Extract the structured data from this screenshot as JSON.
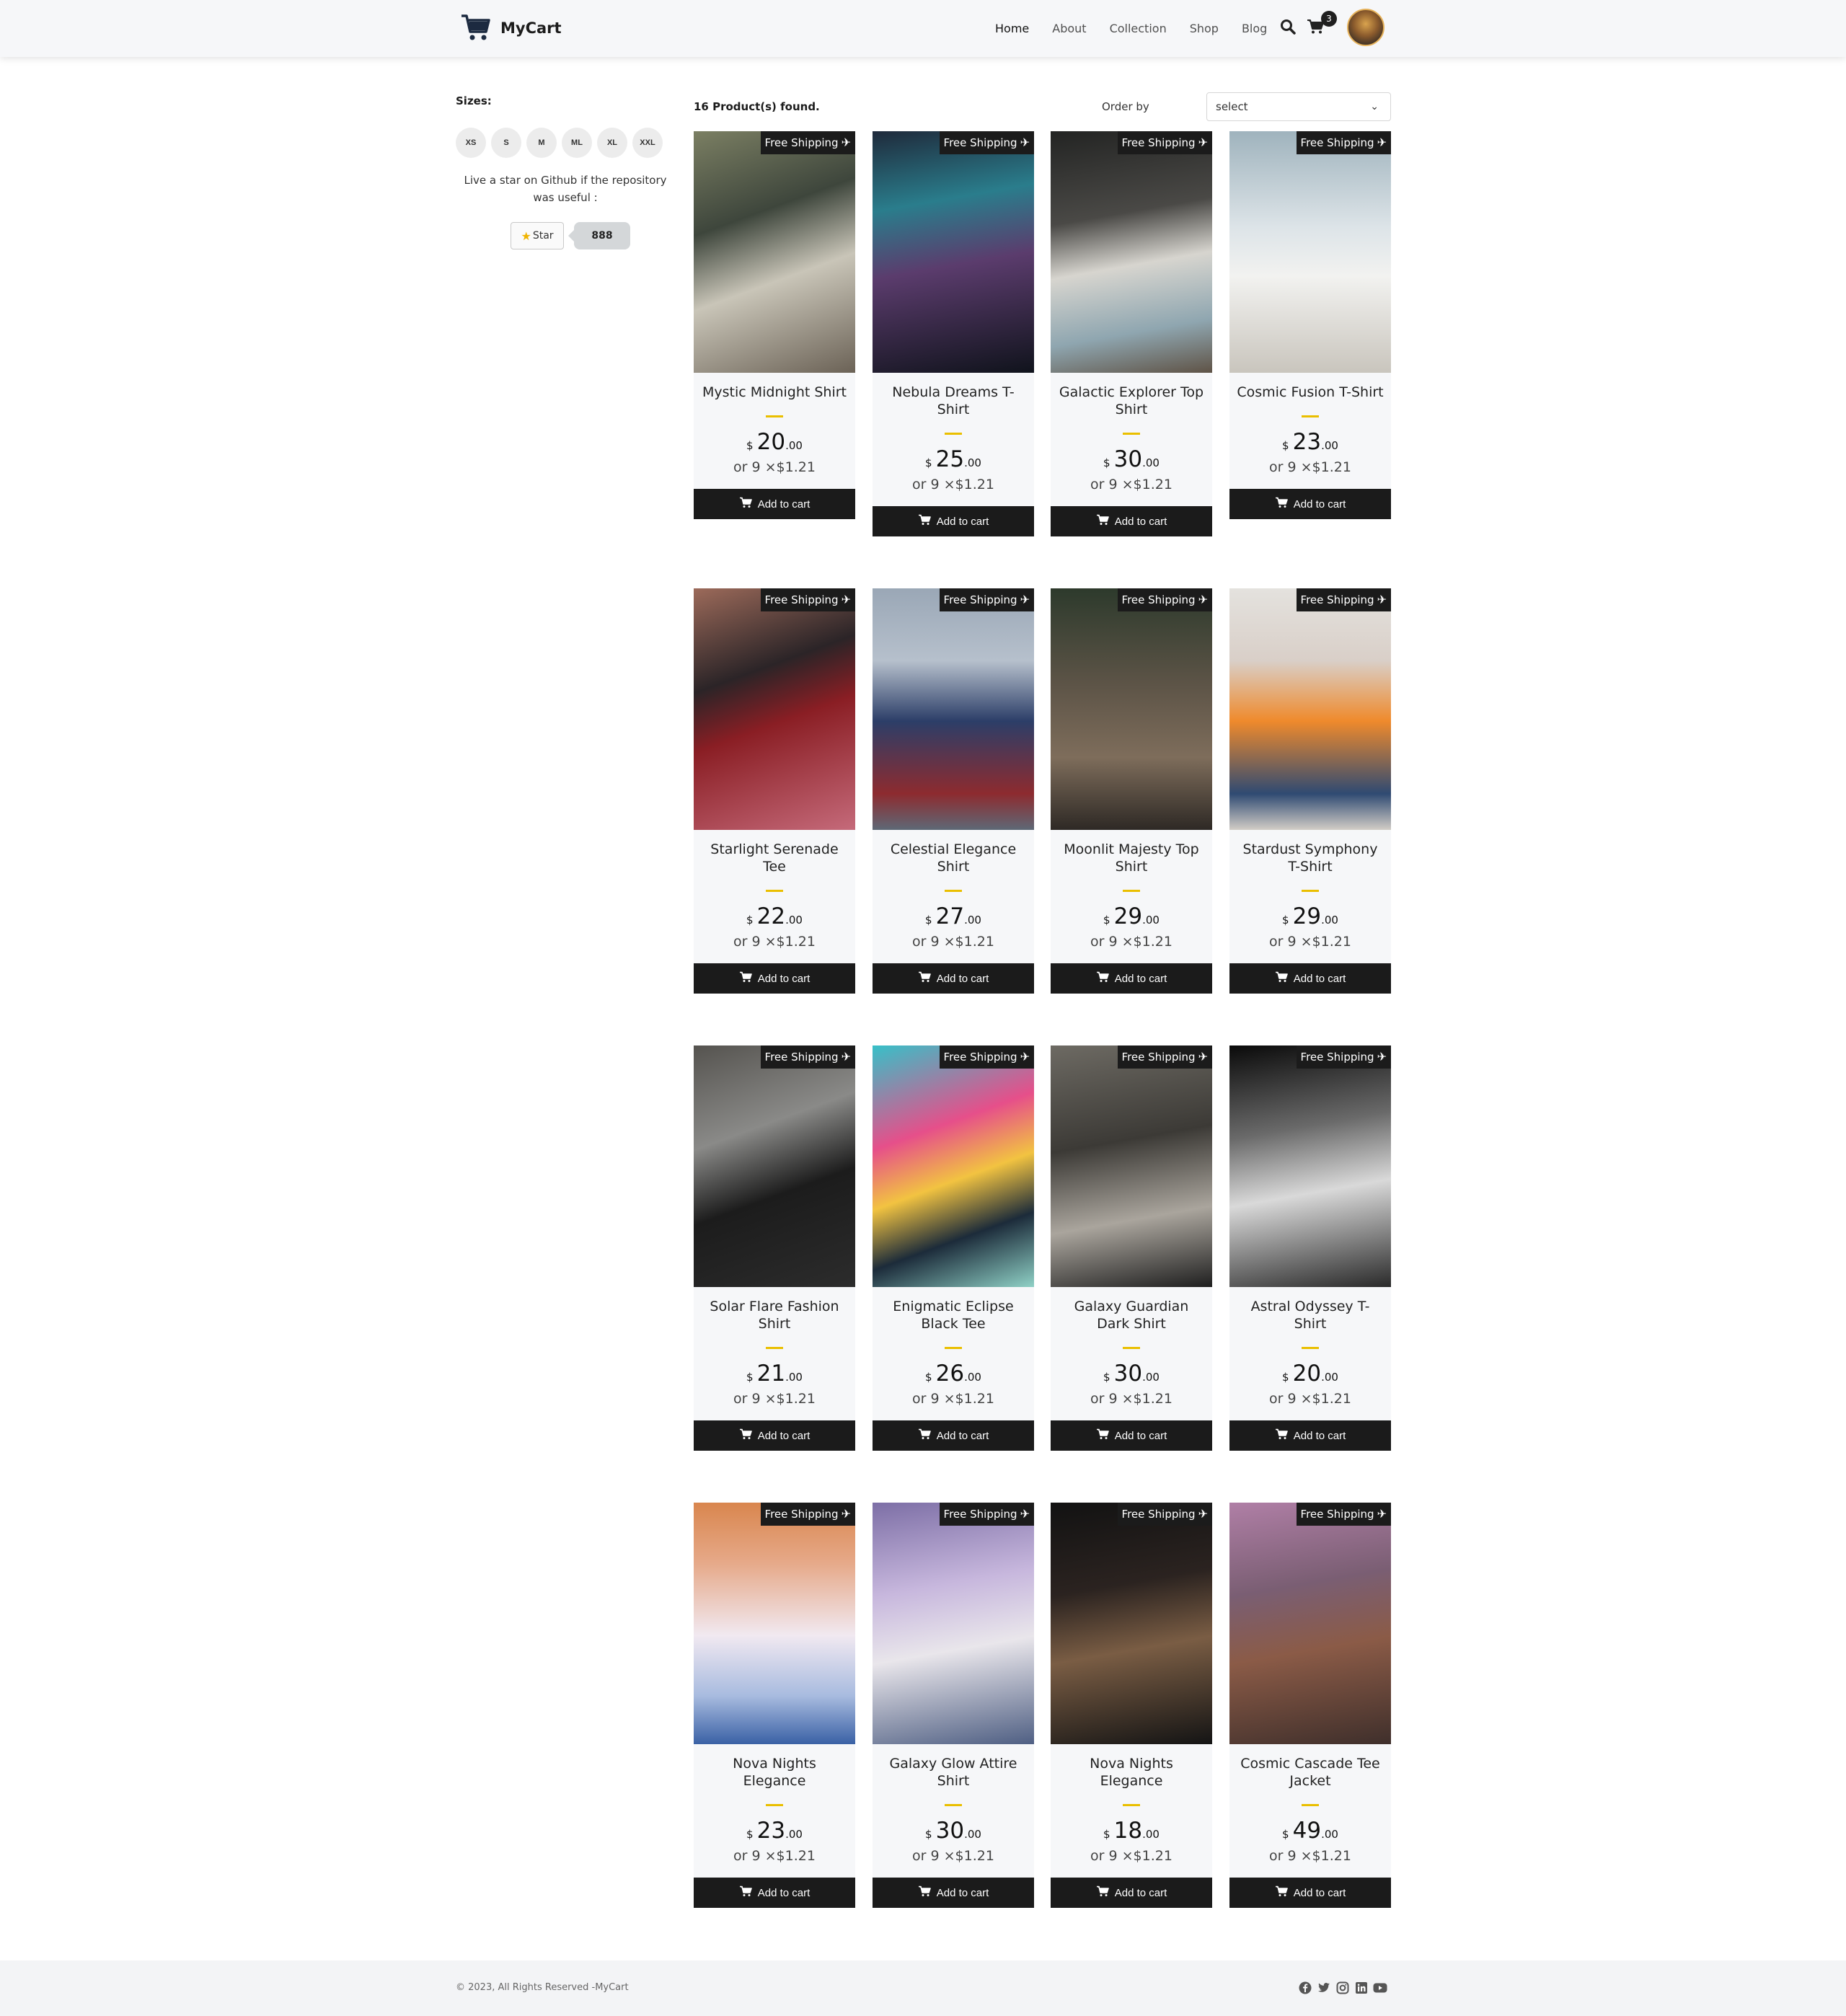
{
  "header": {
    "brand": "MyCart",
    "nav": [
      "Home",
      "About",
      "Collection",
      "Shop",
      "Blog"
    ],
    "cart_count": "3"
  },
  "sidebar": {
    "sizes_title": "Sizes:",
    "sizes": [
      "XS",
      "S",
      "M",
      "ML",
      "XL",
      "XXL"
    ],
    "github_text": "Live a star on Github if the repository was useful :",
    "star_label": "Star",
    "star_count": "888"
  },
  "shelf": {
    "found": "16 Product(s) found.",
    "order_label": "Order by",
    "order_value": "select"
  },
  "product_labels": {
    "shipping": "Free Shipping",
    "add": "Add to cart",
    "currency": "$"
  },
  "products": [
    {
      "title": "Mystic Midnight Shirt",
      "int": "20",
      "dec": ".00",
      "inst": "or 9 ×$1.21"
    },
    {
      "title": "Nebula Dreams T-Shirt",
      "int": "25",
      "dec": ".00",
      "inst": "or 9 ×$1.21"
    },
    {
      "title": "Galactic Explorer Top Shirt",
      "int": "30",
      "dec": ".00",
      "inst": "or 9 ×$1.21"
    },
    {
      "title": "Cosmic Fusion T-Shirt",
      "int": "23",
      "dec": ".00",
      "inst": "or 9 ×$1.21"
    },
    {
      "title": "Starlight Serenade Tee",
      "int": "22",
      "dec": ".00",
      "inst": "or 9 ×$1.21"
    },
    {
      "title": "Celestial Elegance Shirt",
      "int": "27",
      "dec": ".00",
      "inst": "or 9 ×$1.21"
    },
    {
      "title": "Moonlit Majesty Top Shirt",
      "int": "29",
      "dec": ".00",
      "inst": "or 9 ×$1.21"
    },
    {
      "title": "Stardust Symphony T-Shirt",
      "int": "29",
      "dec": ".00",
      "inst": "or 9 ×$1.21"
    },
    {
      "title": "Solar Flare Fashion Shirt",
      "int": "21",
      "dec": ".00",
      "inst": "or 9 ×$1.21"
    },
    {
      "title": "Enigmatic Eclipse Black Tee",
      "int": "26",
      "dec": ".00",
      "inst": "or 9 ×$1.21"
    },
    {
      "title": "Galaxy Guardian Dark Shirt",
      "int": "30",
      "dec": ".00",
      "inst": "or 9 ×$1.21"
    },
    {
      "title": "Astral Odyssey T-Shirt",
      "int": "20",
      "dec": ".00",
      "inst": "or 9 ×$1.21"
    },
    {
      "title": "Nova Nights Elegance",
      "int": "23",
      "dec": ".00",
      "inst": "or 9 ×$1.21"
    },
    {
      "title": "Galaxy Glow Attire Shirt",
      "int": "30",
      "dec": ".00",
      "inst": "or 9 ×$1.21"
    },
    {
      "title": "Nova Nights Elegance",
      "int": "18",
      "dec": ".00",
      "inst": "or 9 ×$1.21"
    },
    {
      "title": "Cosmic Cascade Tee Jacket",
      "int": "49",
      "dec": ".00",
      "inst": "or 9 ×$1.21"
    }
  ],
  "footer": {
    "copyright": "© 2023, All Rights Reserved -MyCart",
    "socials": [
      "facebook-icon",
      "twitter-icon",
      "instagram-icon",
      "linkedin-icon",
      "youtube-icon"
    ]
  },
  "colors": {
    "accent": "#eabf00",
    "dark": "#1b1b1b",
    "card_bg": "#f6f7f9"
  }
}
